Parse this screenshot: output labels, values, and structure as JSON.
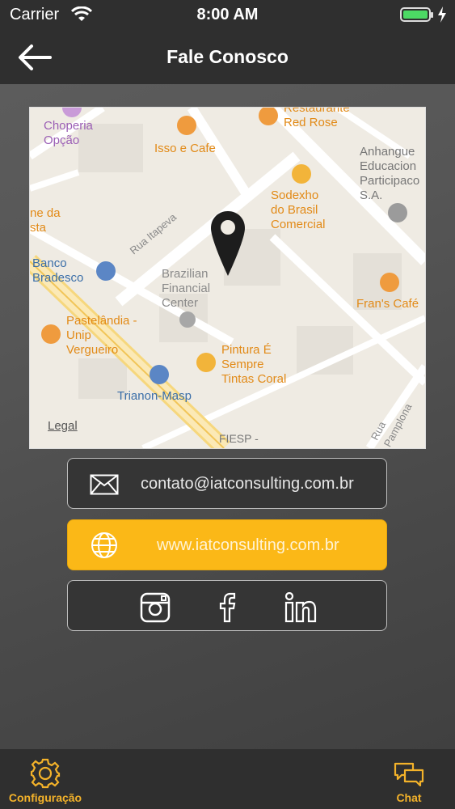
{
  "status_bar": {
    "carrier": "Carrier",
    "time": "8:00 AM"
  },
  "nav": {
    "title": "Fale Conosco",
    "back_icon": "arrow-left-icon"
  },
  "map": {
    "labels": {
      "choperia": "Choperia\nOpção",
      "isso_cafe": "Isso e Cafe",
      "restaurante": "Restaurante\nRed Rose",
      "anhanguera": "Anhangue\nEducacion\nParticipaco\nS.A.",
      "sodexho": "Sodexho\ndo Brasil\nComercial",
      "ne_da": "ne da\nsta",
      "rua_itapeva": "Rua Itapeva",
      "banco": "Banco\nBradesco",
      "bfc": "Brazilian\nFinancial\nCenter",
      "frans": "Fran's Café",
      "pastelandia": "Pastelândia -\nUnip\nVergueiro",
      "pintura": "Pintura É\nSempre\nTintas Coral",
      "trianon": "Trianon-Masp",
      "rua_pamplona": "Rua Pamplona",
      "fiesp": "FIESP -",
      "legal": "Legal"
    }
  },
  "contact": {
    "email": "contato@iatconsulting.com.br",
    "website": "www.iatconsulting.com.br",
    "social": [
      "instagram",
      "facebook",
      "linkedin"
    ]
  },
  "tabbar": {
    "config_label": "Configuração",
    "chat_label": "Chat"
  },
  "colors": {
    "accent": "#fbb817",
    "bar": "#2f2f2f",
    "tab_label": "#f3b22a"
  }
}
